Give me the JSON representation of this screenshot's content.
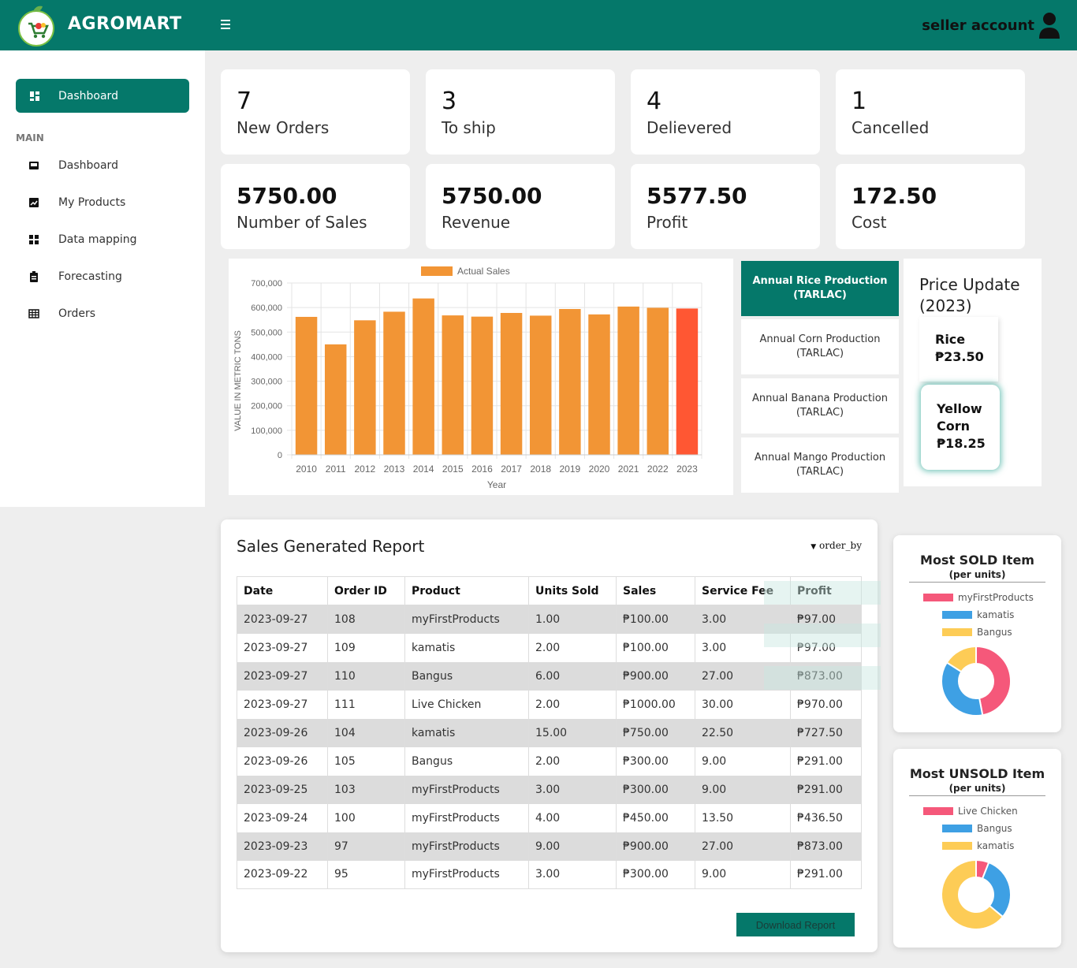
{
  "header": {
    "brand": "AGROMART",
    "account": "seller account"
  },
  "sidebar": {
    "active": "Dashboard",
    "section": "MAIN",
    "items": [
      {
        "label": "Dashboard",
        "icon": "inbox-icon"
      },
      {
        "label": "My Products",
        "icon": "chart-line-icon"
      },
      {
        "label": "Data mapping",
        "icon": "grid-icon"
      },
      {
        "label": "Forecasting",
        "icon": "clipboard-icon"
      },
      {
        "label": "Orders",
        "icon": "table-icon"
      }
    ]
  },
  "stats": [
    {
      "value": "7",
      "label": "New Orders"
    },
    {
      "value": "3",
      "label": "To ship"
    },
    {
      "value": "4",
      "label": "Delievered"
    },
    {
      "value": "1",
      "label": "Cancelled"
    },
    {
      "value": "5750.00",
      "label": "Number of Sales"
    },
    {
      "value": "5750.00",
      "label": "Revenue"
    },
    {
      "value": "5577.50",
      "label": "Profit"
    },
    {
      "value": "172.50",
      "label": "Cost"
    }
  ],
  "chart_data": {
    "type": "bar",
    "legend": "Actual Sales",
    "xlabel": "Year",
    "ylabel": "VALUE IN METRIC TONS",
    "ylim": [
      0,
      700000
    ],
    "yticks": [
      "0",
      "100,000",
      "200,000",
      "300,000",
      "400,000",
      "500,000",
      "600,000",
      "700,000"
    ],
    "categories": [
      "2010",
      "2011",
      "2012",
      "2013",
      "2014",
      "2015",
      "2016",
      "2017",
      "2018",
      "2019",
      "2020",
      "2021",
      "2022",
      "2023"
    ],
    "values": [
      562000,
      450000,
      548000,
      583000,
      637000,
      568000,
      563000,
      578000,
      567000,
      594000,
      572000,
      604000,
      599000,
      596000
    ],
    "colors": {
      "bar": "#f29535",
      "highlight": "#ff5733"
    }
  },
  "production_tabs": [
    {
      "line1": "Annual Rice Production",
      "line2": "(TARLAC)"
    },
    {
      "line1": "Annual Corn Production",
      "line2": "(TARLAC)"
    },
    {
      "line1": "Annual Banana Production",
      "line2": "(TARLAC)"
    },
    {
      "line1": "Annual Mango Production",
      "line2": "(TARLAC)"
    }
  ],
  "price_update": {
    "title": "Price Update (2023)",
    "items": [
      {
        "name": "Rice",
        "price": "₱23.50"
      },
      {
        "name": "Yellow Corn",
        "price": "₱18.25"
      }
    ]
  },
  "report": {
    "title": "Sales Generated Report",
    "order_by": "order_by",
    "columns": [
      "Date",
      "Order ID",
      "Product",
      "Units Sold",
      "Sales",
      "Service Fee",
      "Profit"
    ],
    "rows": [
      [
        "2023-09-27",
        "108",
        "myFirstProducts",
        "1.00",
        "₱100.00",
        "3.00",
        "₱97.00"
      ],
      [
        "2023-09-27",
        "109",
        "kamatis",
        "2.00",
        "₱100.00",
        "3.00",
        "₱97.00"
      ],
      [
        "2023-09-27",
        "110",
        "Bangus",
        "6.00",
        "₱900.00",
        "27.00",
        "₱873.00"
      ],
      [
        "2023-09-27",
        "111",
        "Live Chicken",
        "2.00",
        "₱1000.00",
        "30.00",
        "₱970.00"
      ],
      [
        "2023-09-26",
        "104",
        "kamatis",
        "15.00",
        "₱750.00",
        "22.50",
        "₱727.50"
      ],
      [
        "2023-09-26",
        "105",
        "Bangus",
        "2.00",
        "₱300.00",
        "9.00",
        "₱291.00"
      ],
      [
        "2023-09-25",
        "103",
        "myFirstProducts",
        "3.00",
        "₱300.00",
        "9.00",
        "₱291.00"
      ],
      [
        "2023-09-24",
        "100",
        "myFirstProducts",
        "4.00",
        "₱450.00",
        "13.50",
        "₱436.50"
      ],
      [
        "2023-09-23",
        "97",
        "myFirstProducts",
        "9.00",
        "₱900.00",
        "27.00",
        "₱873.00"
      ],
      [
        "2023-09-22",
        "95",
        "myFirstProducts",
        "3.00",
        "₱300.00",
        "9.00",
        "₱291.00"
      ]
    ],
    "download": "Download Report"
  },
  "most_sold": {
    "title": "Most SOLD Item",
    "subtitle": "(per units)",
    "items": [
      {
        "name": "myFirstProducts",
        "value": 47,
        "color": "#f5587a"
      },
      {
        "name": "kamatis",
        "value": 37,
        "color": "#3ea0e4"
      },
      {
        "name": "Bangus",
        "value": 16,
        "color": "#fdcc56"
      }
    ]
  },
  "most_unsold": {
    "title": "Most UNSOLD Item",
    "subtitle": "(per units)",
    "items": [
      {
        "name": "Live Chicken",
        "value": 6,
        "color": "#f5587a"
      },
      {
        "name": "Bangus",
        "value": 30,
        "color": "#3ea0e4"
      },
      {
        "name": "kamatis",
        "value": 64,
        "color": "#fdcc56"
      }
    ]
  }
}
